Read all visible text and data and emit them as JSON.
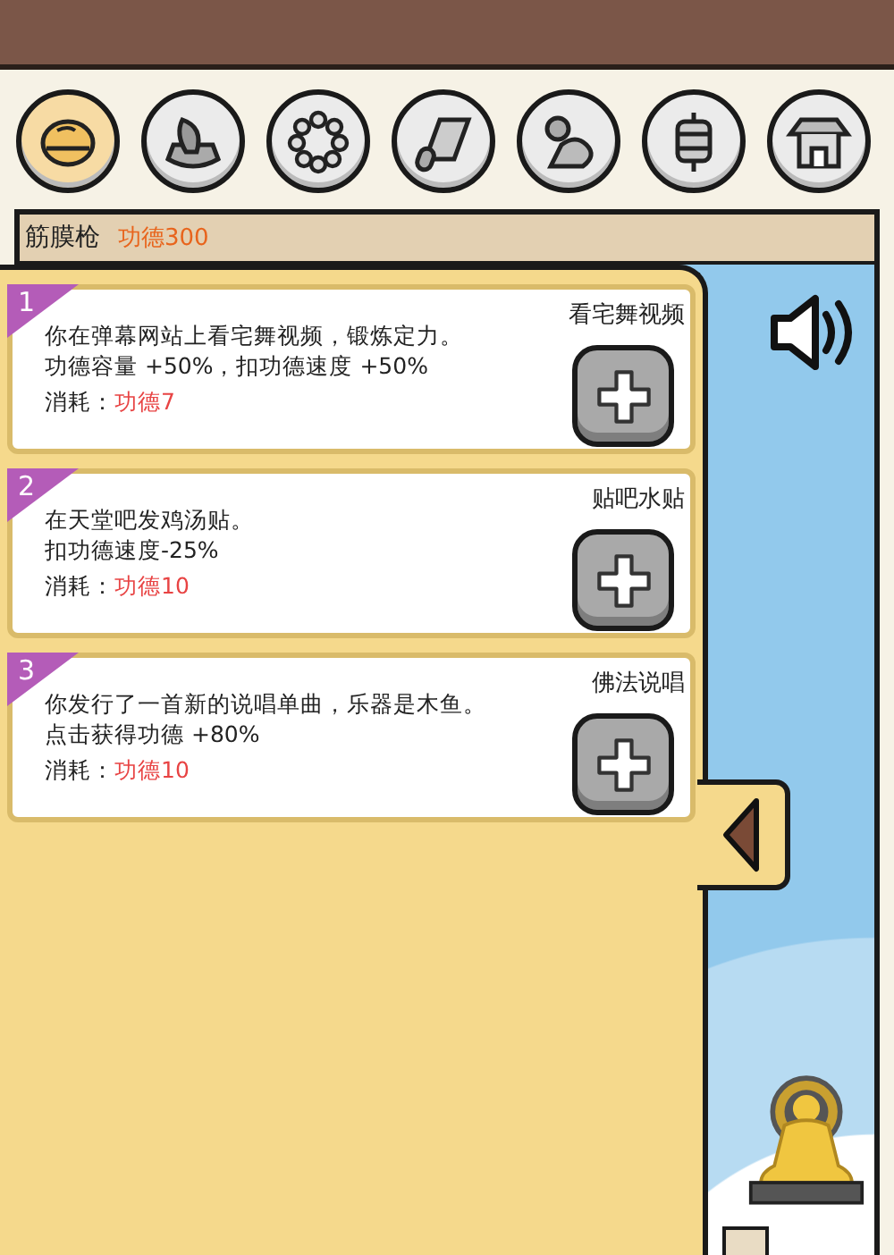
{
  "tabs": [
    {
      "selected": true
    },
    {
      "selected": false
    },
    {
      "selected": false
    },
    {
      "selected": false
    },
    {
      "selected": false
    },
    {
      "selected": false
    },
    {
      "selected": false
    }
  ],
  "header": {
    "name": "筋膜枪",
    "merit": "功德300"
  },
  "cards": [
    {
      "number": "1",
      "title": "看宅舞视频",
      "lines": [
        "你在弹幕网站上看宅舞视频，锻炼定力。",
        "功德容量 +50%，扣功德速度 +50%"
      ],
      "cost_label": "消耗：",
      "cost": "功德7"
    },
    {
      "number": "2",
      "title": "贴吧水贴",
      "lines": [
        "在天堂吧发鸡汤贴。",
        "扣功德速度-25%"
      ],
      "cost_label": "消耗：",
      "cost": "功德10"
    },
    {
      "number": "3",
      "title": "佛法说唱",
      "lines": [
        "你发行了一首新的说唱单曲，乐器是木鱼。",
        "点击获得功德 +80%"
      ],
      "cost_label": "消耗：",
      "cost": "功德10"
    }
  ]
}
